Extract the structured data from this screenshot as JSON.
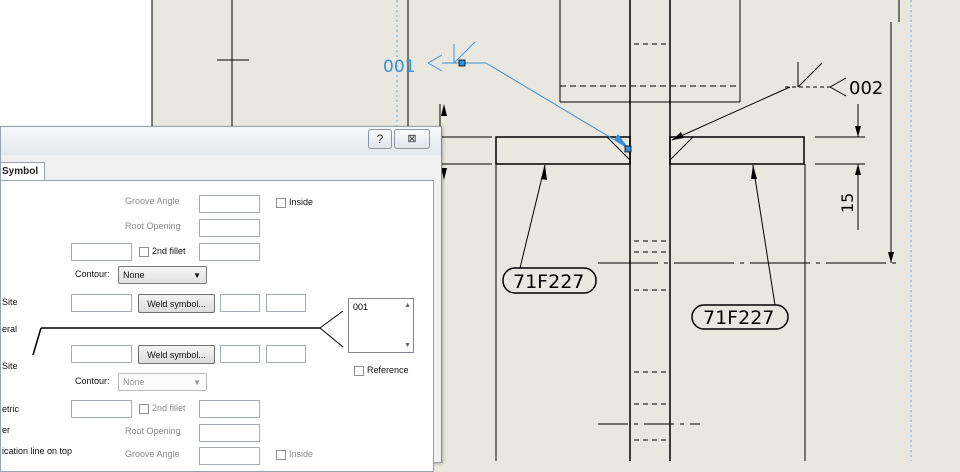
{
  "drawing": {
    "weld_label_1": "001",
    "weld_label_2": "002",
    "part_mark_1": "71F227",
    "part_mark_2": "71F227",
    "dimension": "15"
  },
  "dialog": {
    "help_btn": "?",
    "close_btn": "⊠",
    "tab_symbol": "Symbol",
    "groove_angle_top": "Groove Angle",
    "inside_top": "Inside",
    "root_opening_top": "Root Opening",
    "second_fillet_top": "2nd fillet",
    "contour_label_top": "Contour:",
    "contour_value_top": "None",
    "site_top": "Site",
    "weld_symbol_top": "Weld symbol...",
    "general": "eral",
    "site_bottom": "Site",
    "weld_symbol_bottom": "Weld symbol...",
    "contour_label_bottom": "Contour:",
    "contour_value_bottom": "None",
    "symmetric": "etric",
    "other": "er",
    "second_fillet_bottom": "2nd fillet",
    "root_opening_bottom": "Root Opening",
    "identification_line": "ication line on top",
    "groove_angle_bottom": "Groove Angle",
    "inside_bottom": "Inside",
    "list_value": "001",
    "reference": "Reference"
  },
  "colors": {
    "background": "#e9e8e0",
    "selection_blue": "#3a8fd8",
    "line": "#000000"
  }
}
